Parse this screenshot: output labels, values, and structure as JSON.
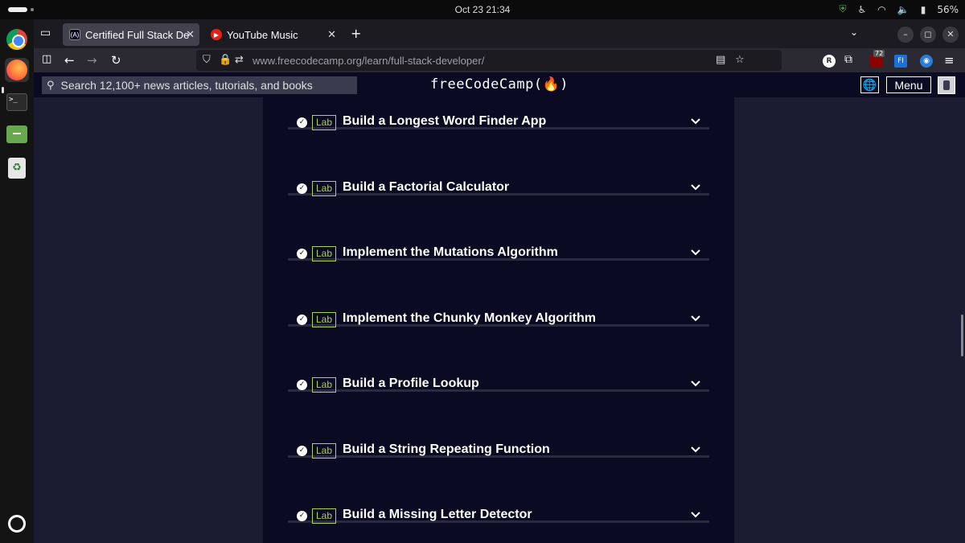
{
  "system": {
    "clock": "Oct 23  21:34",
    "battery": "56%"
  },
  "tabs": [
    {
      "label": "Certified Full Stack Devel",
      "favicon": "(A)"
    },
    {
      "label": "YouTube Music",
      "favicon": "▶"
    }
  ],
  "address": {
    "domain": "www.freecodecamp.org",
    "path": "/learn/full-stack-developer/"
  },
  "extensions": {
    "badge_count": "72",
    "fi_label": "FI",
    "r_label": "R"
  },
  "fcc": {
    "search_placeholder": "Search 12,100+ news articles, tutorials, and books",
    "logo": "freeCodeCamp(🔥)",
    "menu_label": "Menu"
  },
  "labs": [
    {
      "badge": "Lab",
      "title": "Build a Longest Word Finder App"
    },
    {
      "badge": "Lab",
      "title": "Build a Factorial Calculator"
    },
    {
      "badge": "Lab",
      "title": "Implement the Mutations Algorithm"
    },
    {
      "badge": "Lab",
      "title": "Implement the Chunky Monkey Algorithm"
    },
    {
      "badge": "Lab",
      "title": "Build a Profile Lookup"
    },
    {
      "badge": "Lab",
      "title": "Build a String Repeating Function"
    },
    {
      "badge": "Lab",
      "title": "Build a Missing Letter Detector"
    }
  ],
  "colors": {
    "accent": "#acd157",
    "page_bg": "#0a0a23",
    "side_bg": "#1b1b32"
  }
}
